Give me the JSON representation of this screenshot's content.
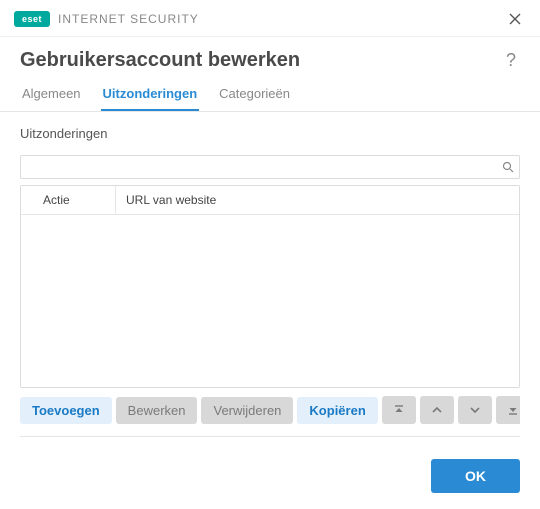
{
  "titlebar": {
    "logo_text": "eset",
    "product_name": "INTERNET SECURITY"
  },
  "header": {
    "title": "Gebruikersaccount bewerken",
    "help_label": "?"
  },
  "tabs": {
    "general": "Algemeen",
    "exceptions": "Uitzonderingen",
    "categories": "Categorieën"
  },
  "section": {
    "label": "Uitzonderingen"
  },
  "table": {
    "columns": {
      "action": "Actie",
      "url": "URL van website"
    },
    "rows": []
  },
  "buttons": {
    "add": "Toevoegen",
    "edit": "Bewerken",
    "delete": "Verwijderen",
    "copy": "Kopiëren",
    "ok": "OK"
  }
}
